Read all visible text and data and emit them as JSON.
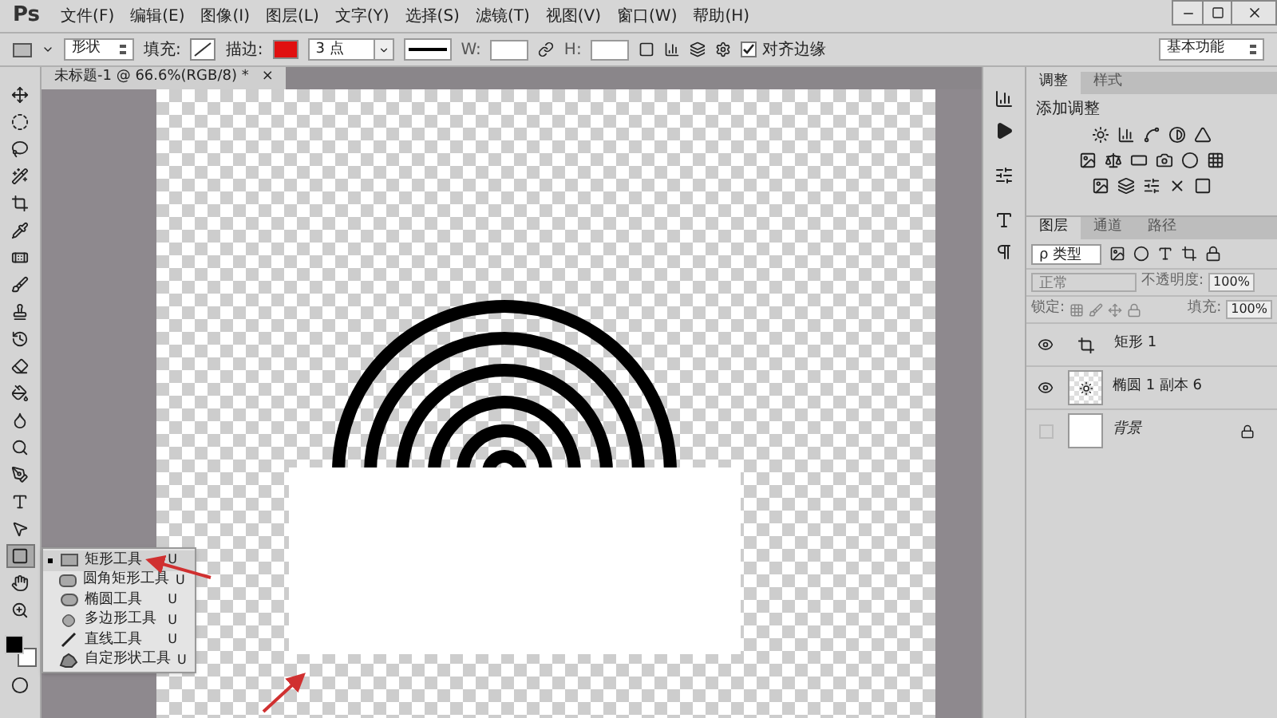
{
  "app": {
    "logo": "Ps"
  },
  "menu": [
    "文件(F)",
    "编辑(E)",
    "图像(I)",
    "图层(L)",
    "文字(Y)",
    "选择(S)",
    "滤镜(T)",
    "视图(V)",
    "窗口(W)",
    "帮助(H)"
  ],
  "options_bar": {
    "mode": "形状",
    "fill_label": "填充:",
    "stroke_label": "描边:",
    "stroke": {
      "color": "#e01010"
    },
    "stroke_width": "3 点",
    "w_label": "W:",
    "h_label": "H:",
    "align_edges": {
      "label": "对齐边缘",
      "checked": true
    },
    "workspace": "基本功能"
  },
  "document_tab": {
    "title": "未标题-1 @ 66.6%(RGB/8) *",
    "close": "×"
  },
  "tools": [
    {
      "kind": "move",
      "selected": false
    },
    {
      "kind": "marquee",
      "selected": false
    },
    {
      "kind": "lasso",
      "selected": false
    },
    {
      "kind": "wand",
      "selected": false
    },
    {
      "kind": "crop",
      "selected": false
    },
    {
      "kind": "eyedropper",
      "selected": false
    },
    {
      "kind": "heal",
      "selected": false
    },
    {
      "kind": "brush",
      "selected": false
    },
    {
      "kind": "stamp",
      "selected": false
    },
    {
      "kind": "history",
      "selected": false
    },
    {
      "kind": "eraser",
      "selected": false
    },
    {
      "kind": "bucket",
      "selected": false
    },
    {
      "kind": "blur",
      "selected": false
    },
    {
      "kind": "dodge",
      "selected": false
    },
    {
      "kind": "pen",
      "selected": false
    },
    {
      "kind": "type",
      "selected": false
    },
    {
      "kind": "path",
      "selected": false
    },
    {
      "kind": "shape",
      "selected": true
    },
    {
      "kind": "hand",
      "selected": false
    },
    {
      "kind": "zoom",
      "selected": false
    }
  ],
  "flyout": [
    {
      "kind": "rect",
      "label": "矩形工具",
      "shortcut": "U",
      "selected": true
    },
    {
      "kind": "rounded",
      "label": "圆角矩形工具",
      "shortcut": "U",
      "selected": false
    },
    {
      "kind": "ellipse",
      "label": "椭圆工具",
      "shortcut": "U",
      "selected": false
    },
    {
      "kind": "polygon",
      "label": "多边形工具",
      "shortcut": "U",
      "selected": false
    },
    {
      "kind": "line",
      "label": "直线工具",
      "shortcut": "U",
      "selected": false
    },
    {
      "kind": "custom",
      "label": "自定形状工具",
      "shortcut": "U",
      "selected": false
    }
  ],
  "adjustments_panel": {
    "tabs": [
      {
        "label": "调整",
        "selected": true
      },
      {
        "label": "样式",
        "selected": false
      }
    ],
    "heading": "添加调整"
  },
  "layers_panel": {
    "tabs": [
      {
        "label": "图层",
        "selected": true
      },
      {
        "label": "通道",
        "selected": false
      },
      {
        "label": "路径",
        "selected": false
      }
    ],
    "filter": "ρ 类型",
    "blend_mode": "正常",
    "opacity_label": "不透明度:",
    "opacity": "100%",
    "lock_label": "锁定:",
    "fill_label": "填充:",
    "fill": "100%",
    "layers": [
      {
        "kind": "shape",
        "name": "矩形 1",
        "visible": true,
        "locked": false
      },
      {
        "kind": "pixel",
        "name": "椭圆 1 副本 6",
        "visible": true,
        "locked": false
      },
      {
        "kind": "background",
        "name": "背景",
        "visible": false,
        "locked": true
      }
    ]
  }
}
